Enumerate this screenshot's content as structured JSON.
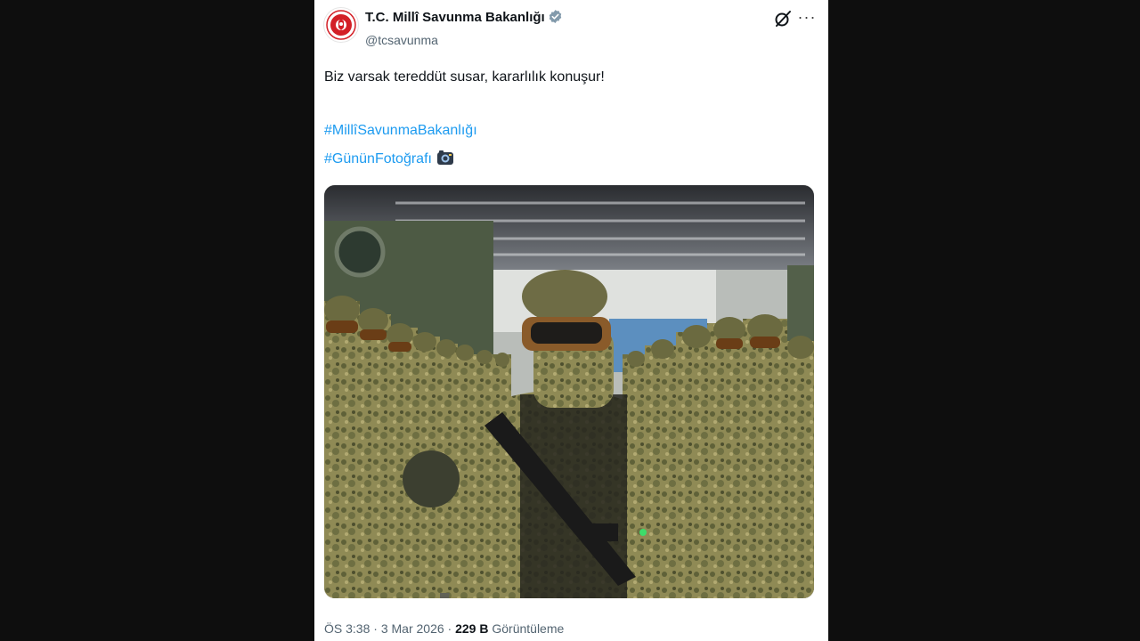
{
  "post": {
    "author_name": "T.C. Millî Savunma Bakanlığı",
    "author_handle": "@tcsavunma",
    "text": "Biz varsak tereddüt susar, kararlılık konuşur!",
    "hashtags": [
      "#MillîSavunmaBakanlığı",
      "#GününFotoğrafı"
    ],
    "time": "ÖS 3:38",
    "separator": "·",
    "date": "3 Mar 2026",
    "views_count": "229 B",
    "views_label": "Görüntüleme"
  },
  "icons": {
    "verified": "verified-badge-icon",
    "grok": "grok-icon",
    "more": "more-icon",
    "camera": "camera-icon",
    "avatar": "turkish-mod-emblem"
  },
  "colors": {
    "link": "#1d9bf0",
    "text": "#0f1419",
    "muted": "#536471",
    "verified": "#829aab",
    "emblem_red": "#d31f26"
  }
}
